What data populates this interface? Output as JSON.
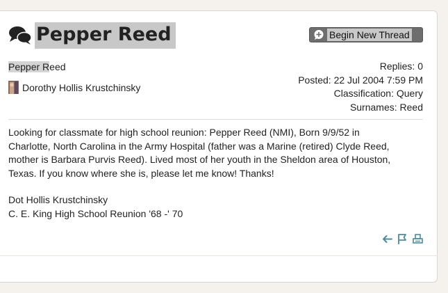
{
  "thread": {
    "title": "Pepper Reed",
    "begin_label": "Begin New Thread",
    "author_label": "Pepper Reed",
    "author_highlight": "Pepper R",
    "author_rest": "eed",
    "submitter": "Dorothy Hollis Krustchinsky"
  },
  "meta": {
    "replies": "Replies: 0",
    "posted": "Posted: 22 Jul 2004 7:59 PM",
    "classification": "Classification: Query",
    "surnames": "Surnames: Reed"
  },
  "message": {
    "line1": "Looking for classmate for high school reunion:  Pepper Reed (NMI), Born 9/9/52 in",
    "line2": "Charlotte, North Carolina in the Army Hospital (father was a Marine (retired) Clyde Reed,",
    "line3": "mother is Barbara Purvis Reed).  Lived most of her youth in the Sheldon area of Houston,",
    "line4": "Texas.  If you know where she is, please let me know!  Thanks!",
    "sig1": "Dot Hollis Krustchinsky",
    "sig2": "C. E. King High School Reunion '68 -' 70"
  },
  "icons": {
    "title_icon": "chat-bubbles-icon",
    "begin_icon": "add-comment-icon",
    "reply_icon": "reply-arrow-icon",
    "flag_icon": "flag-icon",
    "print_icon": "print-icon",
    "accent": "#4a8c9c"
  }
}
